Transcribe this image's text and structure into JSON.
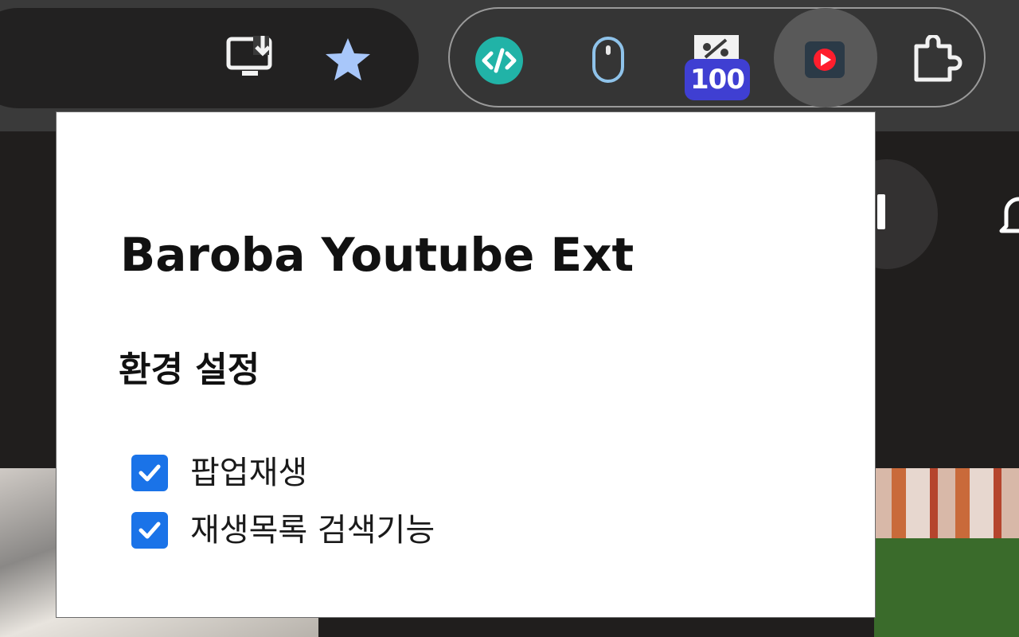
{
  "toolbar": {
    "buttons": [
      {
        "name": "install-app-icon"
      },
      {
        "name": "bookmark-star-icon",
        "state": "bookmarked"
      }
    ],
    "extensions": [
      {
        "name": "code-extension-icon"
      },
      {
        "name": "mouse-extension-icon"
      },
      {
        "name": "percent-extension-icon",
        "badge": "100"
      },
      {
        "name": "youtube-ext-icon",
        "active": true
      },
      {
        "name": "puzzle-extensions-icon"
      }
    ]
  },
  "popup": {
    "title": "Baroba Youtube Ext",
    "section_title": "환경 설정",
    "options": [
      {
        "label": "팝업재생",
        "checked": true
      },
      {
        "label": "재생목록 검색기능",
        "checked": true
      }
    ]
  },
  "colors": {
    "checkbox": "#1a73e8",
    "badge": "#3f3fd2",
    "star": "#a8c7fa",
    "code_ext": "#21b3a7",
    "yt_red": "#ff1e2d"
  }
}
